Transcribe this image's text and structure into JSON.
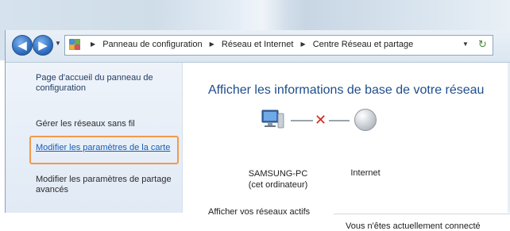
{
  "address_bar": {
    "crumbs": [
      "Panneau de configuration",
      "Réseau et Internet",
      "Centre Réseau et partage"
    ]
  },
  "sidebar": {
    "home_link": "Page d'accueil du panneau de configuration",
    "links": [
      {
        "label": "Gérer les réseaux sans fil"
      },
      {
        "label": "Modifier les paramètres de la carte"
      },
      {
        "label": "Modifier les paramètres de partage avancés"
      }
    ]
  },
  "main": {
    "title": "Afficher les informations de base de votre réseau",
    "computer_name": "SAMSUNG-PC",
    "computer_sub": "(cet ordinateur)",
    "internet_label": "Internet",
    "active_networks_label": "Afficher vos réseaux actifs",
    "not_connected_text": "Vous n'êtes actuellement connecté"
  },
  "colors": {
    "link_active": "#1a5fb4",
    "title": "#1e4e8c",
    "highlight": "#f39a4a",
    "error_x": "#d42b1e"
  },
  "icons": {
    "back": "arrow-left-icon",
    "forward": "arrow-right-icon",
    "control_panel": "control-panel-icon",
    "refresh": "refresh-icon",
    "computer": "computer-icon",
    "disconnected": "disconnected-x-icon",
    "internet": "globe-icon"
  }
}
